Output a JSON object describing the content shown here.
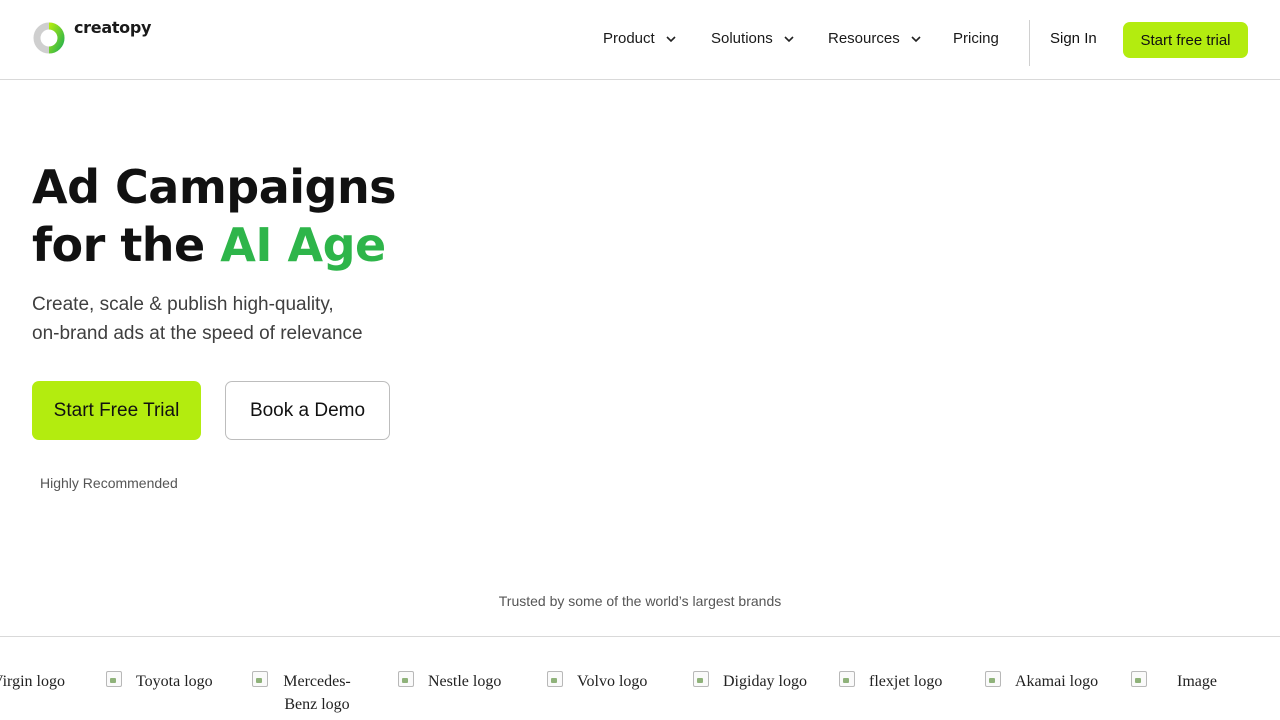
{
  "brand": {
    "name": "creatopy"
  },
  "nav": {
    "items": [
      {
        "label": "Product",
        "has_dropdown": true
      },
      {
        "label": "Solutions",
        "has_dropdown": true
      },
      {
        "label": "Resources",
        "has_dropdown": true
      },
      {
        "label": "Pricing",
        "has_dropdown": false
      }
    ],
    "sign_in": "Sign In",
    "cta": "Start free trial"
  },
  "hero": {
    "title_line1": "Ad Campaigns",
    "title_line2_prefix": "for the ",
    "title_line2_accent": "AI Age",
    "subtitle_line1": "Create, scale & publish high-quality,",
    "subtitle_line2": "on-brand ads at the speed of relevance",
    "primary_button": "Start Free Trial",
    "secondary_button": "Book a Demo",
    "recommended": "Highly Recommended"
  },
  "trusted": {
    "text": "Trusted by some of the world’s largest brands",
    "logos": [
      "Virgin logo",
      "Toyota logo",
      "Mercedes-Benz logo",
      "Nestle logo",
      "Volvo logo",
      "Digiday logo",
      "flexjet logo",
      "Akamai logo",
      "Image"
    ]
  },
  "colors": {
    "accent_lime": "#b3ec0f",
    "accent_green": "#2eb54a",
    "text_dark": "#111111",
    "text_muted": "#555555"
  }
}
